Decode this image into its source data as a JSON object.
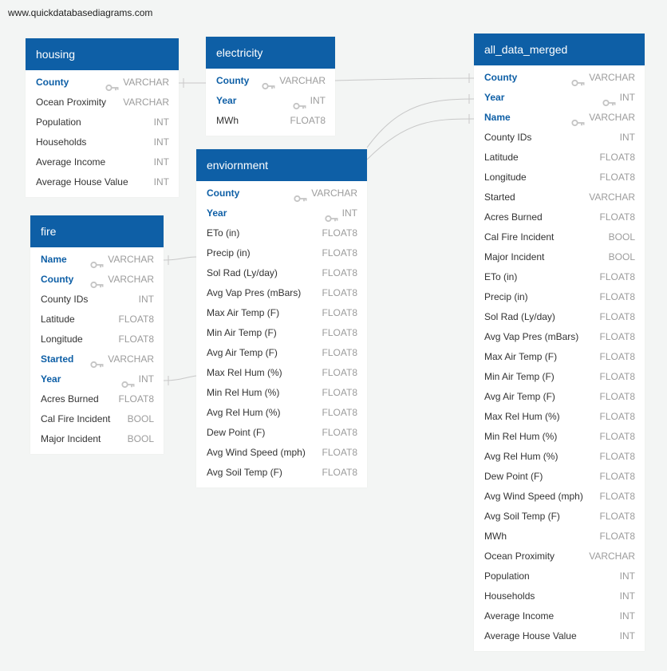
{
  "watermark": "www.quickdatabasediagrams.com",
  "tables": {
    "housing": {
      "title": "housing",
      "fields": [
        {
          "name": "County",
          "type": "VARCHAR",
          "pk": true
        },
        {
          "name": "Ocean Proximity",
          "type": "VARCHAR",
          "pk": false
        },
        {
          "name": "Population",
          "type": "INT",
          "pk": false
        },
        {
          "name": "Households",
          "type": "INT",
          "pk": false
        },
        {
          "name": "Average Income",
          "type": "INT",
          "pk": false
        },
        {
          "name": "Average House Value",
          "type": "INT",
          "pk": false
        }
      ]
    },
    "electricity": {
      "title": "electricity",
      "fields": [
        {
          "name": "County",
          "type": "VARCHAR",
          "pk": true
        },
        {
          "name": "Year",
          "type": "INT",
          "pk": true
        },
        {
          "name": "MWh",
          "type": "FLOAT8",
          "pk": false
        }
      ]
    },
    "fire": {
      "title": "fire",
      "fields": [
        {
          "name": "Name",
          "type": "VARCHAR",
          "pk": true
        },
        {
          "name": "County",
          "type": "VARCHAR",
          "pk": true
        },
        {
          "name": "County IDs",
          "type": "INT",
          "pk": false
        },
        {
          "name": "Latitude",
          "type": "FLOAT8",
          "pk": false
        },
        {
          "name": "Longitude",
          "type": "FLOAT8",
          "pk": false
        },
        {
          "name": "Started",
          "type": "VARCHAR",
          "pk": true
        },
        {
          "name": "Year",
          "type": "INT",
          "pk": true
        },
        {
          "name": "Acres Burned",
          "type": "FLOAT8",
          "pk": false
        },
        {
          "name": "Cal Fire Incident",
          "type": "BOOL",
          "pk": false
        },
        {
          "name": "Major Incident",
          "type": "BOOL",
          "pk": false
        }
      ]
    },
    "enviornment": {
      "title": "enviornment",
      "fields": [
        {
          "name": "County",
          "type": "VARCHAR",
          "pk": true
        },
        {
          "name": "Year",
          "type": "INT",
          "pk": true
        },
        {
          "name": "ETo (in)",
          "type": "FLOAT8",
          "pk": false
        },
        {
          "name": "Precip (in)",
          "type": "FLOAT8",
          "pk": false
        },
        {
          "name": "Sol Rad (Ly/day)",
          "type": "FLOAT8",
          "pk": false
        },
        {
          "name": "Avg Vap Pres (mBars)",
          "type": "FLOAT8",
          "pk": false
        },
        {
          "name": "Max Air Temp (F)",
          "type": "FLOAT8",
          "pk": false
        },
        {
          "name": "Min Air Temp (F)",
          "type": "FLOAT8",
          "pk": false
        },
        {
          "name": "Avg Air Temp (F)",
          "type": "FLOAT8",
          "pk": false
        },
        {
          "name": "Max Rel Hum (%)",
          "type": "FLOAT8",
          "pk": false
        },
        {
          "name": "Min Rel Hum (%)",
          "type": "FLOAT8",
          "pk": false
        },
        {
          "name": "Avg Rel Hum (%)",
          "type": "FLOAT8",
          "pk": false
        },
        {
          "name": "Dew Point (F)",
          "type": "FLOAT8",
          "pk": false
        },
        {
          "name": "Avg Wind Speed (mph)",
          "type": "FLOAT8",
          "pk": false
        },
        {
          "name": "Avg Soil Temp (F)",
          "type": "FLOAT8",
          "pk": false
        }
      ]
    },
    "all_data_merged": {
      "title": "all_data_merged",
      "fields": [
        {
          "name": "County",
          "type": "VARCHAR",
          "pk": true
        },
        {
          "name": "Year",
          "type": "INT",
          "pk": true
        },
        {
          "name": "Name",
          "type": "VARCHAR",
          "pk": true
        },
        {
          "name": "County IDs",
          "type": "INT",
          "pk": false
        },
        {
          "name": "Latitude",
          "type": "FLOAT8",
          "pk": false
        },
        {
          "name": "Longitude",
          "type": "FLOAT8",
          "pk": false
        },
        {
          "name": "Started",
          "type": "VARCHAR",
          "pk": false
        },
        {
          "name": "Acres Burned",
          "type": "FLOAT8",
          "pk": false
        },
        {
          "name": "Cal Fire Incident",
          "type": "BOOL",
          "pk": false
        },
        {
          "name": "Major Incident",
          "type": "BOOL",
          "pk": false
        },
        {
          "name": "ETo (in)",
          "type": "FLOAT8",
          "pk": false
        },
        {
          "name": "Precip (in)",
          "type": "FLOAT8",
          "pk": false
        },
        {
          "name": "Sol Rad (Ly/day)",
          "type": "FLOAT8",
          "pk": false
        },
        {
          "name": "Avg Vap Pres (mBars)",
          "type": "FLOAT8",
          "pk": false
        },
        {
          "name": "Max Air Temp (F)",
          "type": "FLOAT8",
          "pk": false
        },
        {
          "name": "Min Air Temp (F)",
          "type": "FLOAT8",
          "pk": false
        },
        {
          "name": "Avg Air Temp (F)",
          "type": "FLOAT8",
          "pk": false
        },
        {
          "name": "Max Rel Hum (%)",
          "type": "FLOAT8",
          "pk": false
        },
        {
          "name": "Min Rel Hum (%)",
          "type": "FLOAT8",
          "pk": false
        },
        {
          "name": "Avg Rel Hum (%)",
          "type": "FLOAT8",
          "pk": false
        },
        {
          "name": "Dew Point (F)",
          "type": "FLOAT8",
          "pk": false
        },
        {
          "name": "Avg Wind Speed (mph)",
          "type": "FLOAT8",
          "pk": false
        },
        {
          "name": "Avg Soil Temp (F)",
          "type": "FLOAT8",
          "pk": false
        },
        {
          "name": "MWh",
          "type": "FLOAT8",
          "pk": false
        },
        {
          "name": "Ocean Proximity",
          "type": "VARCHAR",
          "pk": false
        },
        {
          "name": "Population",
          "type": "INT",
          "pk": false
        },
        {
          "name": "Households",
          "type": "INT",
          "pk": false
        },
        {
          "name": "Average Income",
          "type": "INT",
          "pk": false
        },
        {
          "name": "Average House Value",
          "type": "INT",
          "pk": false
        }
      ]
    }
  },
  "colors": {
    "header": "#0e5fa6",
    "key_field": "#0e5fa6",
    "type_text": "#9c9c9c",
    "connector": "#c8c8c8",
    "background": "#f3f5f4"
  },
  "icons": {
    "primary_key": "key-icon"
  }
}
